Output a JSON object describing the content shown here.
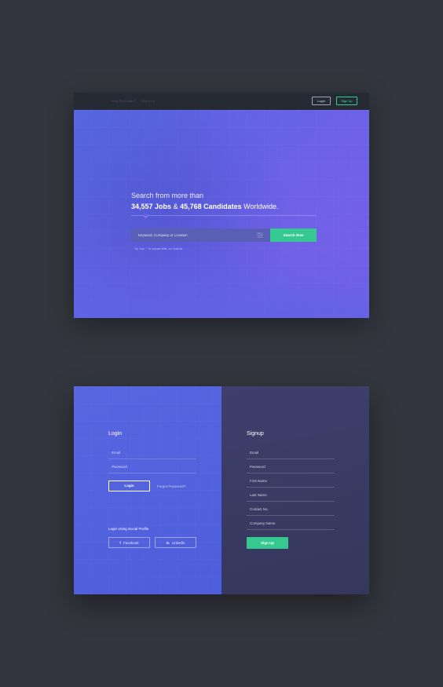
{
  "nav": {
    "links": [
      "Why Recruiters?",
      "About Us"
    ],
    "login_label": "Login",
    "signup_label": "Sign Up"
  },
  "hero": {
    "line1": "Search from more than",
    "jobs_count": "34,557 Jobs",
    "amp": " & ",
    "candidates_count": "45,768 Candidates",
    "worldwide": " Worldwide.",
    "search_placeholder": "Keyword, Company or Location",
    "search_button": "Search Now",
    "hint": "Tip: Use \" \" to include skills, ex: Android"
  },
  "login": {
    "title": "Login",
    "email_label": "Email",
    "password_label": "Password",
    "login_button": "Login",
    "forgot_label": "Forgot Password?",
    "social_label": "Login Using Social Profile",
    "facebook_label": "Facebook",
    "linkedin_label": "Linkedin"
  },
  "signup": {
    "title": "Signup",
    "fields": [
      "Email",
      "Password",
      "First Name",
      "Last Name",
      "Contact No.",
      "Company Name"
    ],
    "signup_button": "Sign Up"
  },
  "colors": {
    "page_bg": "#33363e",
    "nav_bg": "#262a35",
    "accent_green": "#35c890",
    "hero_gradient_start": "#5566de",
    "hero_gradient_end": "#7a5fe8",
    "signup_bg": "#3b3c66"
  }
}
